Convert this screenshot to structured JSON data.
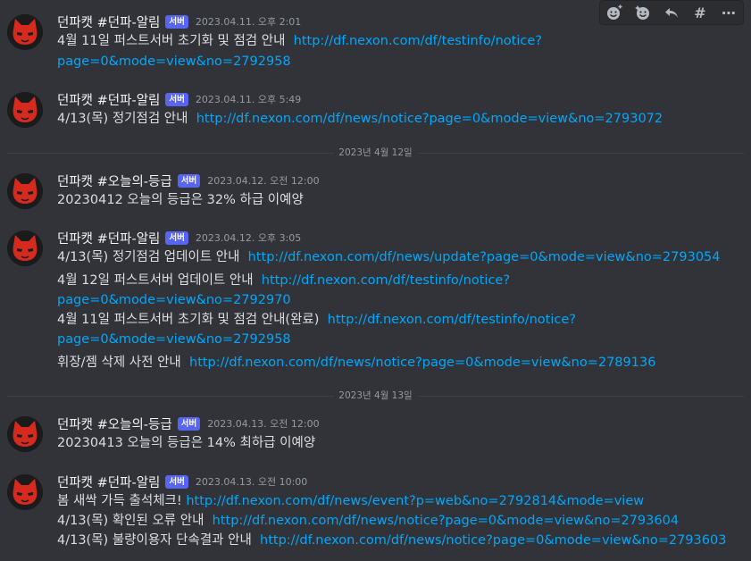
{
  "toolbar": {
    "icons": [
      "add-reaction-icon",
      "super-reaction-icon",
      "reply-icon",
      "create-thread-icon",
      "more-icon"
    ],
    "more_glyph": "⋯",
    "thread_glyph": "#"
  },
  "messages": [
    {
      "user": "던파캣 #던파-알림",
      "badge": "서버",
      "time": "2023.04.11. 오후 2:01",
      "lines": [
        {
          "text": "4월 11일 퍼스트서버 초기화 및 점검 안내",
          "link": "http://df.nexon.com/df/testinfo/notice?"
        },
        {
          "text": "",
          "link": "page=0&mode=view&no=2792958"
        }
      ]
    },
    {
      "user": "던파캣 #던파-알림",
      "badge": "서버",
      "time": "2023.04.11. 오후 5:49",
      "lines": [
        {
          "text": "4/13(목) 정기점검 안내",
          "link": "http://df.nexon.com/df/news/notice?page=0&mode=view&no=2793072"
        }
      ]
    },
    {
      "user": "던파캣 #오늘의-등급",
      "badge": "서버",
      "time": "2023.04.12. 오전 12:00",
      "lines": [
        {
          "text": "20230412 오늘의 등급은 32% 하급 이예양",
          "link": ""
        }
      ]
    },
    {
      "user": "던파캣 #던파-알림",
      "badge": "서버",
      "time": "2023.04.12. 오후 3:05",
      "lines": [
        {
          "text": "4/13(목) 정기점검 업데이트 안내",
          "link": "http://df.nexon.com/df/news/update?page=0&mode=view&no=2793054"
        },
        {
          "text": "4월 12일 퍼스트서버 업데이트 안내",
          "link": "http://df.nexon.com/df/testinfo/notice?"
        },
        {
          "text": "",
          "link": "page=0&mode=view&no=2792970"
        },
        {
          "text": "4월 11일 퍼스트서버 초기화 및 점검 안내(완료)",
          "link": "http://df.nexon.com/df/testinfo/notice?"
        },
        {
          "text": "",
          "link": "page=0&mode=view&no=2792958"
        },
        {
          "text": "휘장/젬 삭제 사전 안내",
          "link": "http://df.nexon.com/df/news/notice?page=0&mode=view&no=2789136"
        }
      ]
    },
    {
      "user": "던파캣 #오늘의-등급",
      "badge": "서버",
      "time": "2023.04.13. 오전 12:00",
      "lines": [
        {
          "text": "20230413 오늘의 등급은 14% 최하급 이예양",
          "link": ""
        }
      ]
    },
    {
      "user": "던파캣 #던파-알림",
      "badge": "서버",
      "time": "2023.04.13. 오전 10:00",
      "lines": [
        {
          "text": "봄 새싹 가득 출석체크!",
          "link": "http://df.nexon.com/df/news/event?p=web&no=2792814&mode=view"
        },
        {
          "text": "4/13(목) 확인된 오류 안내",
          "link": "http://df.nexon.com/df/news/notice?page=0&mode=view&no=2793604"
        },
        {
          "text": "4/13(목) 불량이용자 단속결과 안내",
          "link": "http://df.nexon.com/df/news/notice?page=0&mode=view&no=2793603"
        }
      ]
    }
  ],
  "separators": [
    "2023년 4월 12일",
    "2023년 4월 13일"
  ]
}
